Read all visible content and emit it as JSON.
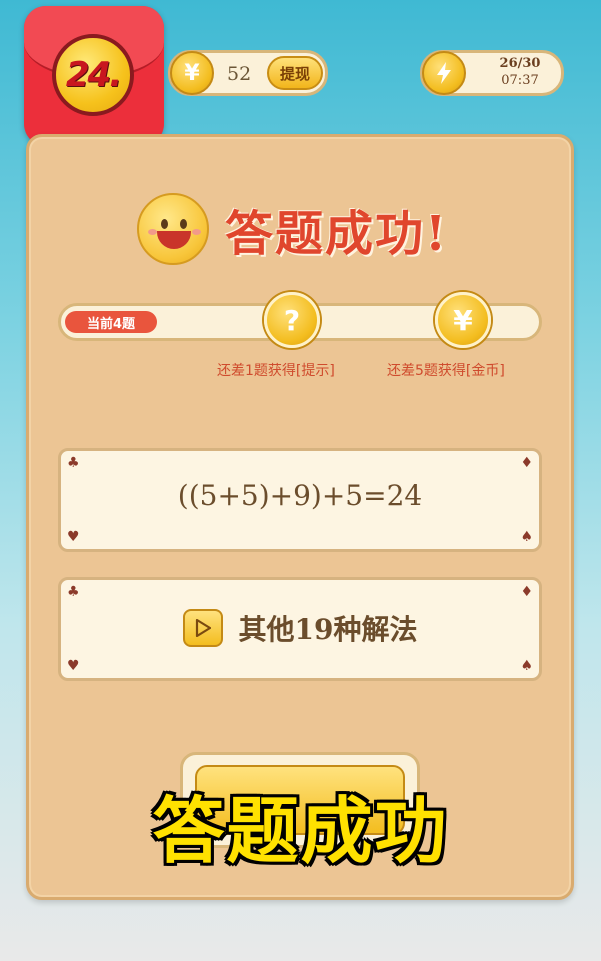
{
  "app_icon": {
    "label": "24."
  },
  "balance": {
    "currency_symbol": "¥",
    "value": "52",
    "withdraw_label": "提现"
  },
  "energy": {
    "count": "26/30",
    "timer": "07:37"
  },
  "result": {
    "title": "答题成功!"
  },
  "progress": {
    "current_label": "当前4题",
    "hint_milestone_icon": "?",
    "coin_milestone_icon": "¥",
    "hint_milestone_label": "还差1题获得[提示]",
    "coin_milestone_label": "还差5题获得[金币]"
  },
  "answer": {
    "expression": "((5+5)+9)+5=24"
  },
  "alternatives": {
    "label": "其他19种解法"
  },
  "card_suits": {
    "club": "♣",
    "diamond": "♦",
    "heart": "♥",
    "spade": "♠"
  },
  "caption": {
    "text": "答题成功"
  },
  "colors": {
    "accent_red": "#e0462d",
    "gold": "#f3bd1f",
    "panel": "#ecc594"
  }
}
